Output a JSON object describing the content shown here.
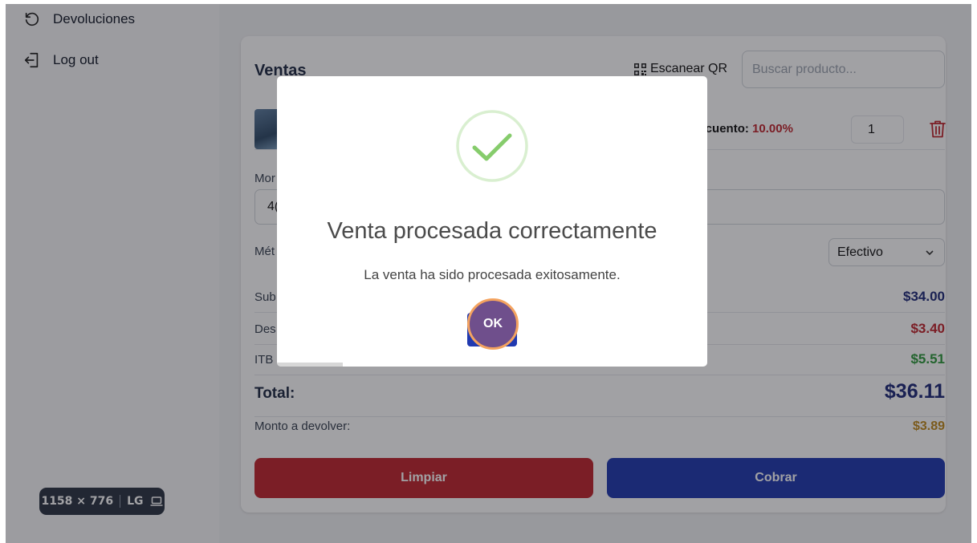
{
  "sidebar": {
    "items": [
      {
        "label": "Devoluciones",
        "icon": "undo-icon"
      },
      {
        "label": "Log out",
        "icon": "logout-icon"
      }
    ]
  },
  "viewport_badge": {
    "size": "1158 × 776",
    "breakpoint": "LG",
    "icon": "laptop-icon"
  },
  "sales": {
    "title": "Ventas",
    "scan_label": "Escanear QR",
    "search_placeholder": "Buscar producto...",
    "product": {
      "discount_label": "escuento:",
      "discount_value": "10.00%",
      "quantity": "1"
    },
    "amount_label": "Mor",
    "amount_value": "4(",
    "method_label": "Mét",
    "method_value": "Efectivo",
    "summary": [
      {
        "label": "Sub",
        "amount": "$34.00",
        "color": "#1e2a78"
      },
      {
        "label": "Des",
        "amount": "$3.40",
        "color": "#c0262d"
      },
      {
        "label": "ITB",
        "amount": "$5.51",
        "color": "#2f9a3c"
      }
    ],
    "total_label": "Total:",
    "total_amount": "$36.11",
    "change_label": "Monto a devolver:",
    "change_amount": "$3.89",
    "clear_label": "Limpiar",
    "charge_label": "Cobrar"
  },
  "modal": {
    "icon": "success-check-icon",
    "title": "Venta procesada correctamente",
    "message": "La venta ha sido procesada exitosamente.",
    "ok_label": "OK",
    "timer_progress": 0.153
  },
  "colors": {
    "primary": "#2039b0",
    "danger": "#c0262d",
    "success": "#2f9a3c",
    "warning": "#c08a1e",
    "click_highlight": "#f4a35f"
  }
}
